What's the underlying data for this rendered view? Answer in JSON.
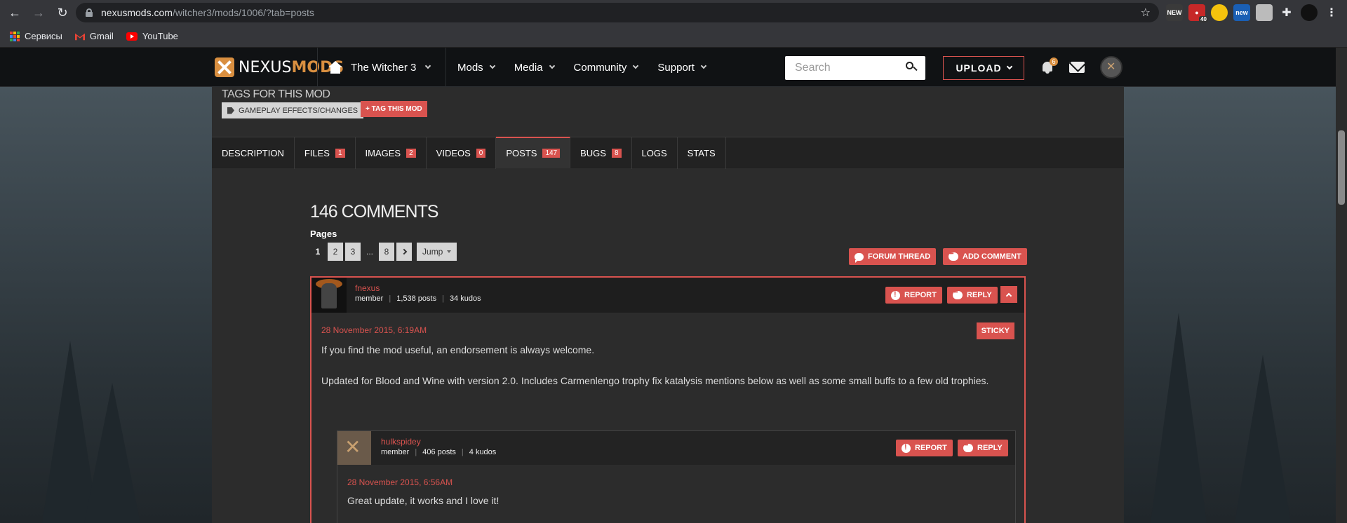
{
  "browser": {
    "url_host": "nexusmods.com",
    "url_path": "/witcher3/mods/1006/?tab=posts",
    "bookmarks": [
      {
        "label": "Сервисы",
        "icon": "apps-grid-icon"
      },
      {
        "label": "Gmail",
        "icon": "gmail-icon"
      },
      {
        "label": "YouTube",
        "icon": "youtube-icon"
      }
    ],
    "extensions": [
      {
        "name": "new-extension-icon",
        "text": "NEW",
        "color": "#3a3a3a"
      },
      {
        "name": "adblock-extension-icon",
        "text": "40",
        "color": "#c62828"
      },
      {
        "name": "yellow-extension-icon",
        "text": "",
        "color": "#f4c20d"
      },
      {
        "name": "new-blue-extension-icon",
        "text": "new",
        "color": "#1a5fb4"
      },
      {
        "name": "photo-extension-icon",
        "text": "",
        "color": "#bbbbbb"
      }
    ]
  },
  "nexus": {
    "logo_text_a": "NEXUS",
    "logo_text_b": "MODS",
    "game": "The Witcher 3",
    "menu": [
      "Mods",
      "Media",
      "Community",
      "Support"
    ],
    "search_placeholder": "Search",
    "upload_label": "UPLOAD",
    "notifications_count": "6"
  },
  "mod": {
    "tags_title": "TAGS FOR THIS MOD",
    "tag": "GAMEPLAY EFFECTS/CHANGES",
    "tag_add": "+ TAG THIS MOD",
    "tabs": [
      {
        "label": "DESCRIPTION",
        "count": ""
      },
      {
        "label": "FILES",
        "count": "1"
      },
      {
        "label": "IMAGES",
        "count": "2"
      },
      {
        "label": "VIDEOS",
        "count": "0"
      },
      {
        "label": "POSTS",
        "count": "147"
      },
      {
        "label": "BUGS",
        "count": "8"
      },
      {
        "label": "LOGS",
        "count": ""
      },
      {
        "label": "STATS",
        "count": ""
      }
    ],
    "active_tab": "POSTS"
  },
  "comments": {
    "title": "146 COMMENTS",
    "pages_label": "Pages",
    "pages": [
      "1",
      "2",
      "3",
      "...",
      "8"
    ],
    "jump_label": "Jump",
    "forum_thread_label": "FORUM THREAD",
    "add_comment_label": "ADD COMMENT",
    "main": {
      "user": "fnexus",
      "role": "member",
      "posts": "1,538 posts",
      "kudos": "34 kudos",
      "report_label": "REPORT",
      "reply_label": "REPLY",
      "date": "28 November 2015, 6:19AM",
      "sticky_label": "STICKY",
      "body_1": "If you find the mod useful, an endorsement is always welcome.",
      "body_2": "Updated for Blood and Wine with version 2.0. Includes Carmenlengo trophy fix katalysis mentions below as well as some small buffs to a few old trophies."
    },
    "reply": {
      "user": "hulkspidey",
      "role": "member",
      "posts": "406 posts",
      "kudos": "4 kudos",
      "report_label": "REPORT",
      "reply_label": "REPLY",
      "date": "28 November 2015, 6:56AM",
      "body": "Great update, it works and I love it!"
    }
  }
}
